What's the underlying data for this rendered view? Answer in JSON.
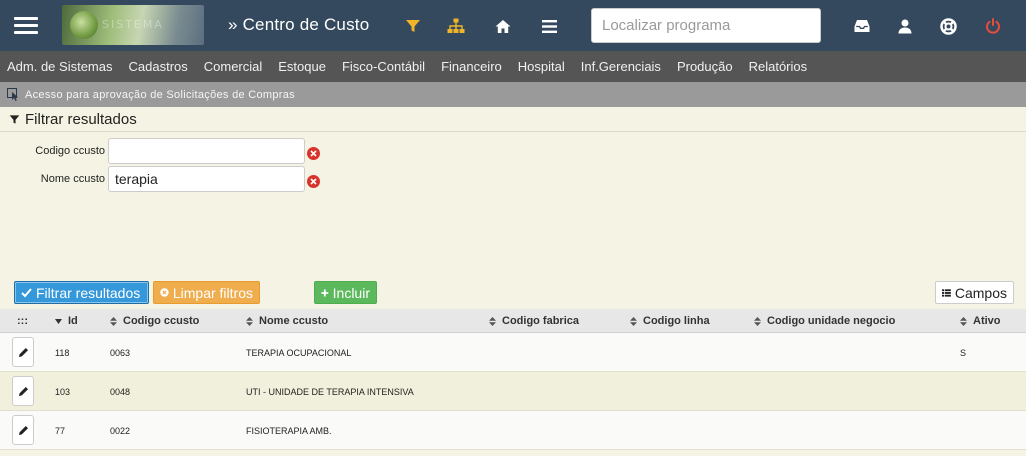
{
  "topbar": {
    "module_title": "» Centro de Custo",
    "search_placeholder": "Localizar programa",
    "icons": [
      "menu-icon",
      "filter-icon",
      "sitemap-icon",
      "home-icon",
      "list-icon",
      "inbox-icon",
      "user-icon",
      "lifebuoy-icon",
      "power-icon"
    ],
    "colors": {
      "bar": "#34495e",
      "accent": "#f0b429",
      "power": "#e74c3c"
    }
  },
  "menu": {
    "items": [
      "Adm. de Sistemas",
      "Cadastros",
      "Comercial",
      "Estoque",
      "Fisco-Contábil",
      "Financeiro",
      "Hospital",
      "Inf.Gerenciais",
      "Produção",
      "Relatórios"
    ]
  },
  "notice": {
    "text": "Acesso para aprovação de Solicitações de Compras"
  },
  "filter": {
    "title": "Filtrar resultados",
    "fields": [
      {
        "label": "Codigo ccusto",
        "value": ""
      },
      {
        "label": "Nome ccusto",
        "value": "terapia"
      }
    ]
  },
  "actions": {
    "filter": "Filtrar resultados",
    "clear": "Limpar filtros",
    "add": "Incluir",
    "fields": "Campos",
    "colors": {
      "filter": "#3498db",
      "clear": "#f0ad4e",
      "add": "#5cb85c"
    }
  },
  "table": {
    "drag_handle": ":::",
    "columns": [
      "Id",
      "Codigo ccusto",
      "Nome ccusto",
      "Codigo fabrica",
      "Codigo linha",
      "Codigo unidade negocio",
      "Ativo"
    ],
    "rows": [
      {
        "id": "118",
        "codigo": "0063",
        "nome": "TERAPIA OCUPACIONAL",
        "fabrica": "",
        "linha": "",
        "unidade": "",
        "ativo": "S"
      },
      {
        "id": "103",
        "codigo": "0048",
        "nome": "UTI - UNIDADE DE TERAPIA INTENSIVA",
        "fabrica": "",
        "linha": "",
        "unidade": "",
        "ativo": ""
      },
      {
        "id": "77",
        "codigo": "0022",
        "nome": "FISIOTERAPIA AMB.",
        "fabrica": "",
        "linha": "",
        "unidade": "",
        "ativo": ""
      }
    ]
  }
}
